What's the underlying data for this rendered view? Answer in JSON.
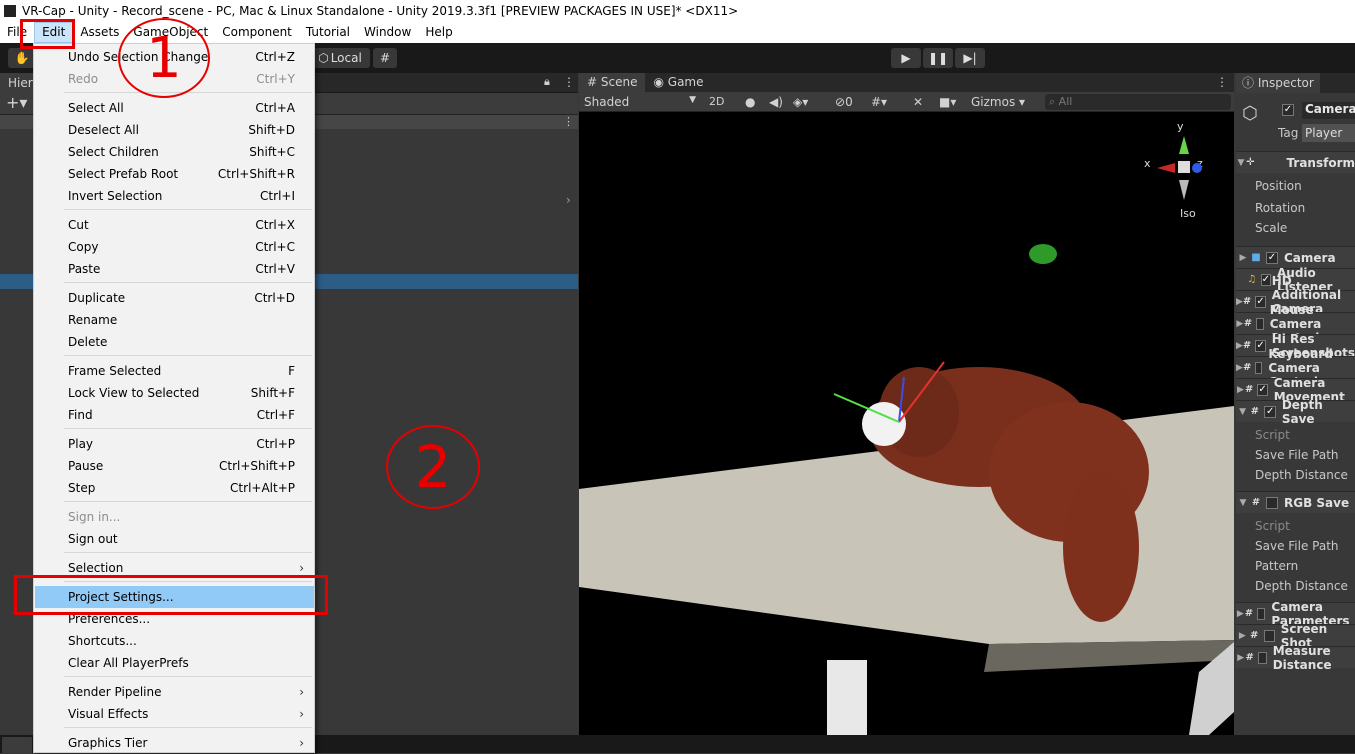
{
  "window_title": "VR-Cap - Unity - Record_scene - PC, Mac & Linux Standalone - Unity 2019.3.3f1 [PREVIEW PACKAGES IN USE]* <DX11>",
  "menubar": [
    "File",
    "Edit",
    "Assets",
    "GameObject",
    "Component",
    "Tutorial",
    "Window",
    "Help"
  ],
  "toolbar": {
    "pivot_mode": "Local"
  },
  "hierarchy": {
    "tab": "Hierarchy"
  },
  "scene": {
    "tabs": [
      "Scene",
      "Game"
    ],
    "draw_mode": "Shaded",
    "mode_2d": "2D",
    "hidden_count": "0",
    "gizmos": "Gizmos",
    "search_placeholder": "All",
    "axis_x": "x",
    "axis_y": "y",
    "axis_z": "z",
    "projection": "Iso"
  },
  "inspector": {
    "tab": "Inspector",
    "object_name": "Camera",
    "tag_label": "Tag",
    "tag_value": "Player",
    "transform": "Transform",
    "position": "Position",
    "rotation": "Rotation",
    "scale": "Scale",
    "components": [
      {
        "name": "Camera",
        "icon": "camera-icon",
        "checked": true
      },
      {
        "name": "Audio Listener",
        "icon": "headphones-icon",
        "checked": true
      },
      {
        "name": "HD Additional Camera Data",
        "icon": "script-icon",
        "checked": true
      },
      {
        "name": "Mouse Camera Control",
        "icon": "script-icon",
        "checked": false
      },
      {
        "name": "Hi Res Screenshots",
        "icon": "script-icon",
        "checked": true
      },
      {
        "name": "Keyboard Camera Control",
        "icon": "script-icon",
        "checked": false
      },
      {
        "name": "Camera Movement",
        "icon": "script-icon",
        "checked": true
      },
      {
        "name": "Depth Save",
        "icon": "script-icon",
        "checked": true
      }
    ],
    "depth_props": [
      "Script",
      "Save File Path",
      "Depth Distance"
    ],
    "rgb_save": "RGB Save",
    "rgb_props": [
      "Script",
      "Save File Path",
      "Pattern",
      "Depth Distance"
    ],
    "more_components": [
      "Camera Parameters",
      "Screen Shot",
      "Measure Distance"
    ]
  },
  "edit_menu": {
    "items": [
      {
        "label": "Undo Selection Change",
        "shortcut": "Ctrl+Z"
      },
      {
        "label": "Redo",
        "shortcut": "Ctrl+Y",
        "disabled": true
      },
      {
        "label": "Select All",
        "shortcut": "Ctrl+A"
      },
      {
        "label": "Deselect All",
        "shortcut": "Shift+D"
      },
      {
        "label": "Select Children",
        "shortcut": "Shift+C"
      },
      {
        "label": "Select Prefab Root",
        "shortcut": "Ctrl+Shift+R"
      },
      {
        "label": "Invert Selection",
        "shortcut": "Ctrl+I"
      },
      {
        "label": "Cut",
        "shortcut": "Ctrl+X"
      },
      {
        "label": "Copy",
        "shortcut": "Ctrl+C"
      },
      {
        "label": "Paste",
        "shortcut": "Ctrl+V"
      },
      {
        "label": "Duplicate",
        "shortcut": "Ctrl+D"
      },
      {
        "label": "Rename",
        "shortcut": ""
      },
      {
        "label": "Delete",
        "shortcut": ""
      },
      {
        "label": "Frame Selected",
        "shortcut": "F"
      },
      {
        "label": "Lock View to Selected",
        "shortcut": "Shift+F"
      },
      {
        "label": "Find",
        "shortcut": "Ctrl+F"
      },
      {
        "label": "Play",
        "shortcut": "Ctrl+P"
      },
      {
        "label": "Pause",
        "shortcut": "Ctrl+Shift+P"
      },
      {
        "label": "Step",
        "shortcut": "Ctrl+Alt+P"
      },
      {
        "label": "Sign in...",
        "shortcut": "",
        "disabled": true
      },
      {
        "label": "Sign out",
        "shortcut": ""
      },
      {
        "label": "Selection",
        "shortcut": "",
        "submenu": true
      },
      {
        "label": "Project Settings...",
        "shortcut": "",
        "highlighted": true
      },
      {
        "label": "Preferences...",
        "shortcut": ""
      },
      {
        "label": "Shortcuts...",
        "shortcut": ""
      },
      {
        "label": "Clear All PlayerPrefs",
        "shortcut": ""
      },
      {
        "label": "Render Pipeline",
        "shortcut": "",
        "submenu": true
      },
      {
        "label": "Visual Effects",
        "shortcut": "",
        "submenu": true
      },
      {
        "label": "Graphics Tier",
        "shortcut": "",
        "submenu": true
      }
    ]
  },
  "annotations": {
    "step1": "1",
    "step2": "2"
  },
  "colors": {
    "annotation": "#e60000",
    "highlight": "#91c9f7",
    "selection": "#2c5d87"
  }
}
